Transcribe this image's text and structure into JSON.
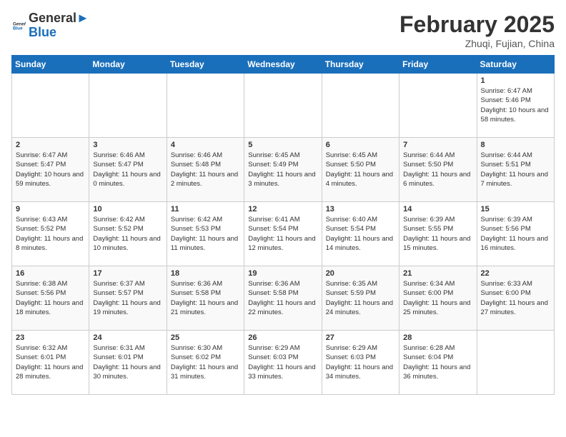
{
  "header": {
    "logo_line1": "General",
    "logo_line2": "Blue",
    "month_title": "February 2025",
    "location": "Zhuqi, Fujian, China"
  },
  "weekdays": [
    "Sunday",
    "Monday",
    "Tuesday",
    "Wednesday",
    "Thursday",
    "Friday",
    "Saturday"
  ],
  "weeks": [
    [
      {
        "day": "",
        "info": ""
      },
      {
        "day": "",
        "info": ""
      },
      {
        "day": "",
        "info": ""
      },
      {
        "day": "",
        "info": ""
      },
      {
        "day": "",
        "info": ""
      },
      {
        "day": "",
        "info": ""
      },
      {
        "day": "1",
        "info": "Sunrise: 6:47 AM\nSunset: 5:46 PM\nDaylight: 10 hours and 58 minutes."
      }
    ],
    [
      {
        "day": "2",
        "info": "Sunrise: 6:47 AM\nSunset: 5:47 PM\nDaylight: 10 hours and 59 minutes."
      },
      {
        "day": "3",
        "info": "Sunrise: 6:46 AM\nSunset: 5:47 PM\nDaylight: 11 hours and 0 minutes."
      },
      {
        "day": "4",
        "info": "Sunrise: 6:46 AM\nSunset: 5:48 PM\nDaylight: 11 hours and 2 minutes."
      },
      {
        "day": "5",
        "info": "Sunrise: 6:45 AM\nSunset: 5:49 PM\nDaylight: 11 hours and 3 minutes."
      },
      {
        "day": "6",
        "info": "Sunrise: 6:45 AM\nSunset: 5:50 PM\nDaylight: 11 hours and 4 minutes."
      },
      {
        "day": "7",
        "info": "Sunrise: 6:44 AM\nSunset: 5:50 PM\nDaylight: 11 hours and 6 minutes."
      },
      {
        "day": "8",
        "info": "Sunrise: 6:44 AM\nSunset: 5:51 PM\nDaylight: 11 hours and 7 minutes."
      }
    ],
    [
      {
        "day": "9",
        "info": "Sunrise: 6:43 AM\nSunset: 5:52 PM\nDaylight: 11 hours and 8 minutes."
      },
      {
        "day": "10",
        "info": "Sunrise: 6:42 AM\nSunset: 5:52 PM\nDaylight: 11 hours and 10 minutes."
      },
      {
        "day": "11",
        "info": "Sunrise: 6:42 AM\nSunset: 5:53 PM\nDaylight: 11 hours and 11 minutes."
      },
      {
        "day": "12",
        "info": "Sunrise: 6:41 AM\nSunset: 5:54 PM\nDaylight: 11 hours and 12 minutes."
      },
      {
        "day": "13",
        "info": "Sunrise: 6:40 AM\nSunset: 5:54 PM\nDaylight: 11 hours and 14 minutes."
      },
      {
        "day": "14",
        "info": "Sunrise: 6:39 AM\nSunset: 5:55 PM\nDaylight: 11 hours and 15 minutes."
      },
      {
        "day": "15",
        "info": "Sunrise: 6:39 AM\nSunset: 5:56 PM\nDaylight: 11 hours and 16 minutes."
      }
    ],
    [
      {
        "day": "16",
        "info": "Sunrise: 6:38 AM\nSunset: 5:56 PM\nDaylight: 11 hours and 18 minutes."
      },
      {
        "day": "17",
        "info": "Sunrise: 6:37 AM\nSunset: 5:57 PM\nDaylight: 11 hours and 19 minutes."
      },
      {
        "day": "18",
        "info": "Sunrise: 6:36 AM\nSunset: 5:58 PM\nDaylight: 11 hours and 21 minutes."
      },
      {
        "day": "19",
        "info": "Sunrise: 6:36 AM\nSunset: 5:58 PM\nDaylight: 11 hours and 22 minutes."
      },
      {
        "day": "20",
        "info": "Sunrise: 6:35 AM\nSunset: 5:59 PM\nDaylight: 11 hours and 24 minutes."
      },
      {
        "day": "21",
        "info": "Sunrise: 6:34 AM\nSunset: 6:00 PM\nDaylight: 11 hours and 25 minutes."
      },
      {
        "day": "22",
        "info": "Sunrise: 6:33 AM\nSunset: 6:00 PM\nDaylight: 11 hours and 27 minutes."
      }
    ],
    [
      {
        "day": "23",
        "info": "Sunrise: 6:32 AM\nSunset: 6:01 PM\nDaylight: 11 hours and 28 minutes."
      },
      {
        "day": "24",
        "info": "Sunrise: 6:31 AM\nSunset: 6:01 PM\nDaylight: 11 hours and 30 minutes."
      },
      {
        "day": "25",
        "info": "Sunrise: 6:30 AM\nSunset: 6:02 PM\nDaylight: 11 hours and 31 minutes."
      },
      {
        "day": "26",
        "info": "Sunrise: 6:29 AM\nSunset: 6:03 PM\nDaylight: 11 hours and 33 minutes."
      },
      {
        "day": "27",
        "info": "Sunrise: 6:29 AM\nSunset: 6:03 PM\nDaylight: 11 hours and 34 minutes."
      },
      {
        "day": "28",
        "info": "Sunrise: 6:28 AM\nSunset: 6:04 PM\nDaylight: 11 hours and 36 minutes."
      },
      {
        "day": "",
        "info": ""
      }
    ]
  ]
}
